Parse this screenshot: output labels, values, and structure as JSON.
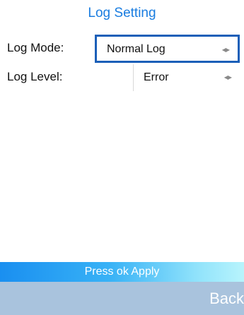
{
  "screen": {
    "title": "Log Setting"
  },
  "settings": {
    "log_mode": {
      "label": "Log Mode:",
      "value": "Normal Log",
      "arrows_icon": "left-right-arrows-icon",
      "focused": true
    },
    "log_level": {
      "label": "Log Level:",
      "value": "Error",
      "arrows_icon": "left-right-arrows-icon",
      "focused": false
    }
  },
  "footer": {
    "hint": "Press ok Apply",
    "back_label": "Back"
  },
  "colors": {
    "title": "#1a7de0",
    "focus_border": "#1b5fb8",
    "bottom_bar": "#a9c3dd",
    "apply_bar_start": "#1a8ff0",
    "apply_bar_end": "#b8f4fc"
  }
}
